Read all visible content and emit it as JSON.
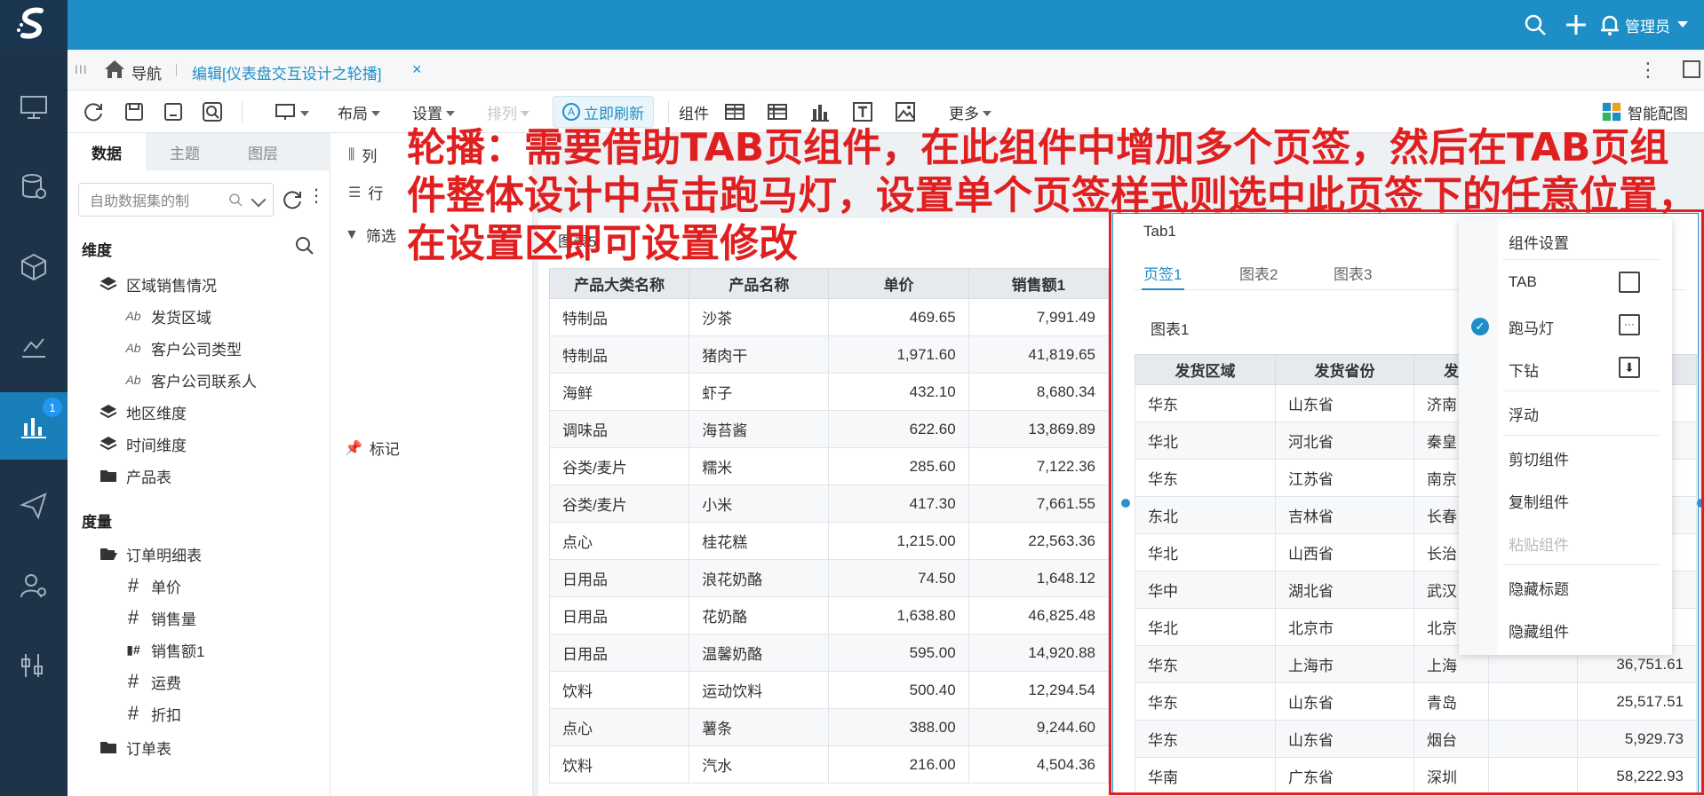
{
  "header": {
    "user": "管理员",
    "nav_badge": "1"
  },
  "tabbar": {
    "nav_label": "导航",
    "edit_tab": "编辑[仪表盘交互设计之轮播]",
    "close": "×"
  },
  "toolbar": {
    "layout": "布局",
    "settings": "设置",
    "arrange": "排列",
    "refresh_now": "立即刷新",
    "component": "组件",
    "more": "更多",
    "smart_layout": "智能配图"
  },
  "data_panel": {
    "tabs": [
      "数据",
      "主题",
      "图层"
    ],
    "dataset_placeholder": "自助数据集的制",
    "dimension_title": "维度",
    "measure_title": "度量",
    "dimensions": [
      {
        "label": "区域销售情况",
        "type": "layers"
      },
      {
        "label": "发货区域",
        "type": "text"
      },
      {
        "label": "客户公司类型",
        "type": "text"
      },
      {
        "label": "客户公司联系人",
        "type": "text"
      },
      {
        "label": "地区维度",
        "type": "layers"
      },
      {
        "label": "时间维度",
        "type": "layers"
      },
      {
        "label": "产品表",
        "type": "folder"
      }
    ],
    "measures": [
      {
        "label": "订单明细表",
        "type": "folder-open"
      },
      {
        "label": "单价",
        "type": "number"
      },
      {
        "label": "销售量",
        "type": "number"
      },
      {
        "label": "销售额1",
        "type": "calc"
      },
      {
        "label": "运费",
        "type": "number"
      },
      {
        "label": "折扣",
        "type": "number"
      },
      {
        "label": "订单表",
        "type": "folder"
      }
    ]
  },
  "shelves": {
    "columns": "列",
    "rows": "行",
    "filter": "筛选",
    "mark": "标记"
  },
  "chart5": {
    "title": "图表5",
    "headers": [
      "产品大类名称",
      "产品名称",
      "单价",
      "销售额1"
    ],
    "rows": [
      [
        "特制品",
        "沙茶",
        "469.65",
        "7,991.49"
      ],
      [
        "特制品",
        "猪肉干",
        "1,971.60",
        "41,819.65"
      ],
      [
        "海鲜",
        "虾子",
        "432.10",
        "8,680.34"
      ],
      [
        "调味品",
        "海苔酱",
        "622.60",
        "13,869.89"
      ],
      [
        "谷类/麦片",
        "糯米",
        "285.60",
        "7,122.36"
      ],
      [
        "谷类/麦片",
        "小米",
        "417.30",
        "7,661.55"
      ],
      [
        "点心",
        "桂花糕",
        "1,215.00",
        "22,563.36"
      ],
      [
        "日用品",
        "浪花奶酪",
        "74.50",
        "1,648.12"
      ],
      [
        "日用品",
        "花奶酪",
        "1,638.80",
        "46,825.48"
      ],
      [
        "日用品",
        "温馨奶酪",
        "595.00",
        "14,920.88"
      ],
      [
        "饮料",
        "运动饮料",
        "500.40",
        "12,294.54"
      ],
      [
        "点心",
        "薯条",
        "388.00",
        "9,244.60"
      ],
      [
        "饮料",
        "汽水",
        "216.00",
        "4,504.36"
      ]
    ]
  },
  "tab_component": {
    "title": "Tab1",
    "tabs": [
      "页签1",
      "图表2",
      "图表3"
    ],
    "chart_title": "图表1",
    "headers": [
      "发货区域",
      "发货省份",
      "发",
      "",
      ""
    ],
    "rows": [
      [
        "华东",
        "山东省",
        "济南",
        "",
        ""
      ],
      [
        "华北",
        "河北省",
        "秦皇",
        "",
        ""
      ],
      [
        "华东",
        "江苏省",
        "南京",
        "",
        ""
      ],
      [
        "东北",
        "吉林省",
        "长春",
        "",
        ""
      ],
      [
        "华北",
        "山西省",
        "长治",
        "",
        ""
      ],
      [
        "华中",
        "湖北省",
        "武汉",
        "",
        ""
      ],
      [
        "华北",
        "北京市",
        "北京",
        "",
        ""
      ],
      [
        "华东",
        "上海市",
        "上海",
        "",
        "36,751.61"
      ],
      [
        "华东",
        "山东省",
        "青岛",
        "",
        "25,517.51"
      ],
      [
        "华东",
        "山东省",
        "烟台",
        "",
        "5,929.73"
      ],
      [
        "华南",
        "广东省",
        "深圳",
        "",
        "58,222.93"
      ]
    ]
  },
  "context_menu": {
    "items": [
      "组件设置",
      "TAB",
      "跑马灯",
      "下钻",
      "浮动",
      "剪切组件",
      "复制组件",
      "粘贴组件",
      "隐藏标题",
      "隐藏组件"
    ],
    "checked": "跑马灯",
    "disabled": "粘贴组件"
  },
  "annotation": "轮播：需要借助TAB页组件，在此组件中增加多个页签，然后在TAB页组件整体设计中点击跑马灯，设置单个页签样式则选中此页签下的任意位置，在设置区即可设置修改"
}
